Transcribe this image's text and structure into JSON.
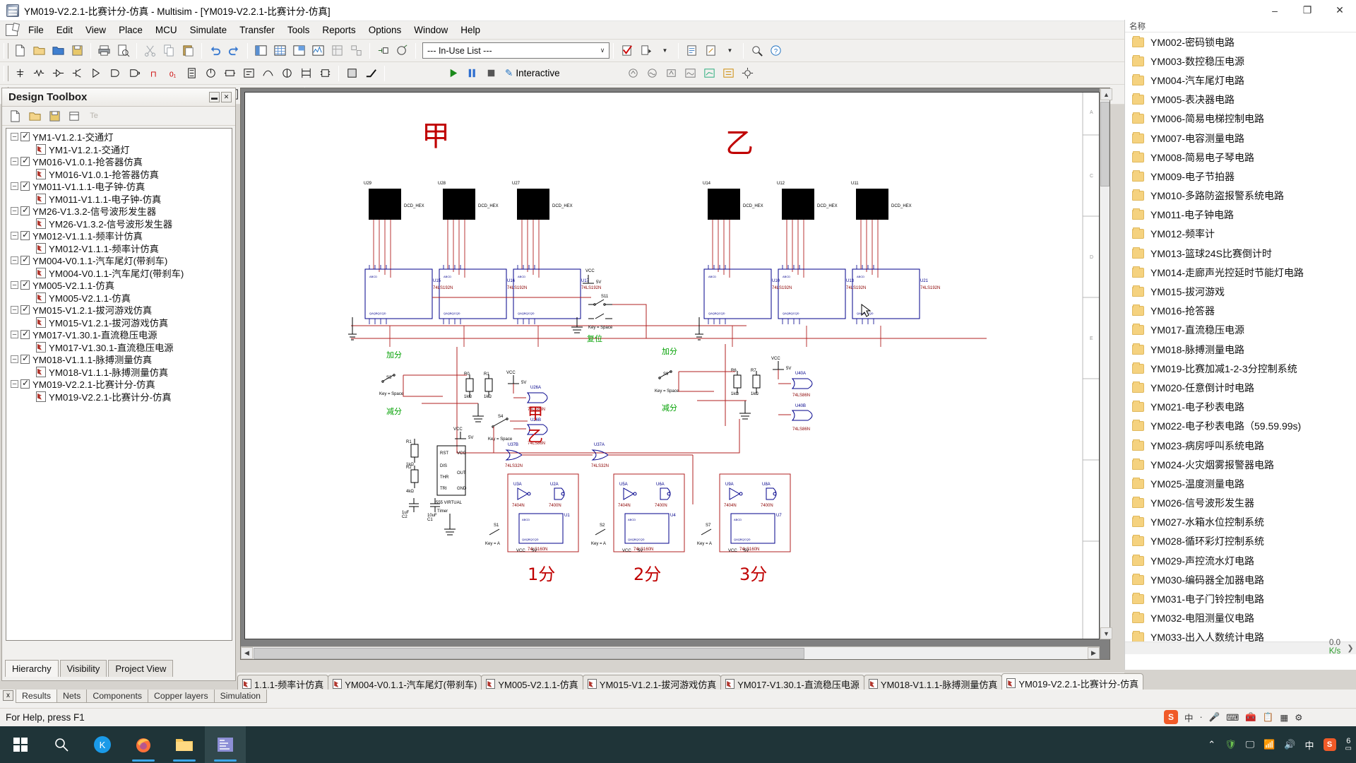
{
  "window": {
    "title": "YM019-V2.2.1-比赛计分-仿真 - Multisim - [YM019-V2.2.1-比赛计分-仿真]",
    "minimize": "–",
    "maximize": "❐",
    "close": "✕"
  },
  "menu": [
    "File",
    "Edit",
    "View",
    "Place",
    "MCU",
    "Simulate",
    "Transfer",
    "Tools",
    "Reports",
    "Options",
    "Window",
    "Help"
  ],
  "toolbar": {
    "in_use_list": "--- In-Use List ---",
    "interactive_label": "Interactive",
    "run_tooltip": "Run",
    "pause_tooltip": "Pause",
    "stop_tooltip": "Stop"
  },
  "design_toolbox": {
    "title": "Design Toolbox",
    "collapse": "▬",
    "close": "✕",
    "tools": [
      "new-sheet-icon",
      "open-icon",
      "save-icon",
      "rename-icon",
      "Te"
    ],
    "tree": [
      {
        "level": 0,
        "label": "YM1-V1.2.1-交通灯",
        "kind": "project"
      },
      {
        "level": 1,
        "label": "YM1-V1.2.1-交通灯",
        "kind": "file"
      },
      {
        "level": 0,
        "label": "YM016-V1.0.1-抢答器仿真",
        "kind": "project"
      },
      {
        "level": 1,
        "label": "YM016-V1.0.1-抢答器仿真",
        "kind": "file"
      },
      {
        "level": 0,
        "label": "YM011-V1.1.1-电子钟-仿真",
        "kind": "project"
      },
      {
        "level": 1,
        "label": "YM011-V1.1.1-电子钟-仿真",
        "kind": "file"
      },
      {
        "level": 0,
        "label": "YM26-V1.3.2-信号波形发生器",
        "kind": "project"
      },
      {
        "level": 1,
        "label": "YM26-V1.3.2-信号波形发生器",
        "kind": "file"
      },
      {
        "level": 0,
        "label": "YM012-V1.1.1-频率计仿真",
        "kind": "project"
      },
      {
        "level": 1,
        "label": "YM012-V1.1.1-频率计仿真",
        "kind": "file"
      },
      {
        "level": 0,
        "label": "YM004-V0.1.1-汽车尾灯(带刹车)",
        "kind": "project"
      },
      {
        "level": 1,
        "label": "YM004-V0.1.1-汽车尾灯(带刹车)",
        "kind": "file"
      },
      {
        "level": 0,
        "label": "YM005-V2.1.1-仿真",
        "kind": "project"
      },
      {
        "level": 1,
        "label": "YM005-V2.1.1-仿真",
        "kind": "file"
      },
      {
        "level": 0,
        "label": "YM015-V1.2.1-拔河游戏仿真",
        "kind": "project"
      },
      {
        "level": 1,
        "label": "YM015-V1.2.1-拔河游戏仿真",
        "kind": "file"
      },
      {
        "level": 0,
        "label": "YM017-V1.30.1-直流稳压电源",
        "kind": "project"
      },
      {
        "level": 1,
        "label": "YM017-V1.30.1-直流稳压电源",
        "kind": "file"
      },
      {
        "level": 0,
        "label": "YM018-V1.1.1-脉搏测量仿真",
        "kind": "project"
      },
      {
        "level": 1,
        "label": "YM018-V1.1.1-脉搏测量仿真",
        "kind": "file"
      },
      {
        "level": 0,
        "label": "YM019-V2.2.1-比赛计分-仿真",
        "kind": "project"
      },
      {
        "level": 1,
        "label": "YM019-V2.2.1-比赛计分-仿真",
        "kind": "file"
      }
    ],
    "panel_tabs": [
      {
        "label": "Hierarchy",
        "active": true
      },
      {
        "label": "Visibility",
        "active": false
      },
      {
        "label": "Project View",
        "active": false
      }
    ]
  },
  "explorer": {
    "header": "名称",
    "items": [
      "YM002-密码锁电路",
      "YM003-数控稳压电源",
      "YM004-汽车尾灯电路",
      "YM005-表决器电路",
      "YM006-简易电梯控制电路",
      "YM007-电容测量电路",
      "YM008-简易电子琴电路",
      "YM009-电子节拍器",
      "YM010-多路防盗报警系统电路",
      "YM011-电子钟电路",
      "YM012-频率计",
      "YM013-篮球24S比赛倒计时",
      "YM014-走廊声光控延时节能灯电路",
      "YM015-拔河游戏",
      "YM016-抢答器",
      "YM017-直流稳压电源",
      "YM018-脉搏测量电路",
      "YM019-比赛加减1-2-3分控制系统",
      "YM020-任意倒计时电路",
      "YM021-电子秒表电路",
      "YM022-电子秒表电路（59.59.99s)",
      "YM023-病房呼叫系统电路",
      "YM024-火灾烟雾报警器电路",
      "YM025-温度测量电路",
      "YM026-信号波形发生器",
      "YM027-水箱水位控制系统",
      "YM028-循环彩灯控制系统",
      "YM029-声控流水灯电路",
      "YM030-编码器全加器电路",
      "YM031-电子门铃控制电路",
      "YM032-电阻测量仪电路",
      "YM033-出入人数统计电路"
    ],
    "scroll_right": "❯",
    "net_speed": "0.0",
    "net_unit": "K/s"
  },
  "doc_tabs": [
    {
      "label": "1.1.1-频率计仿真",
      "active": false
    },
    {
      "label": "YM004-V0.1.1-汽车尾灯(带刹车)",
      "active": false
    },
    {
      "label": "YM005-V2.1.1-仿真",
      "active": false
    },
    {
      "label": "YM015-V1.2.1-拔河游戏仿真",
      "active": false
    },
    {
      "label": "YM017-V1.30.1-直流稳压电源",
      "active": false
    },
    {
      "label": "YM018-V1.1.1-脉搏测量仿真",
      "active": false
    },
    {
      "label": "YM019-V2.2.1-比赛计分-仿真",
      "active": true
    }
  ],
  "tab_nav": [
    "◀",
    "▶",
    "❐"
  ],
  "spreadsheet_tabs": [
    {
      "label": "Results",
      "active": true
    },
    {
      "label": "Nets",
      "active": false
    },
    {
      "label": "Components",
      "active": false
    },
    {
      "label": "Copper layers",
      "active": false
    },
    {
      "label": "Simulation",
      "active": false
    }
  ],
  "status_bar": {
    "text": "For Help, press F1"
  },
  "ime": {
    "brand": "S",
    "mode": "中",
    "dot": "·",
    "icons": [
      "mic-icon",
      "keyboard-icon",
      "toolbox-icon",
      "clipboard-icon",
      "grid-icon",
      "settings-icon"
    ]
  },
  "taskbar": {
    "items": [
      "start-icon",
      "search-icon",
      "kugou-icon",
      "firefox-icon",
      "explorer-icon",
      "multisim-icon"
    ],
    "tray": [
      "chevron-up-icon",
      "shield-icon",
      "network-icon",
      "volume-icon"
    ],
    "ime_label": "中",
    "sogou_label": "S",
    "notification_count": "6"
  },
  "schematic": {
    "labels": {
      "team_left": "甲",
      "team_right": "乙",
      "team_left_low": "甲",
      "team_right_low": "乙",
      "reset": "复位",
      "add_left": "加分",
      "sub_left": "减分",
      "add_right": "加分",
      "sub_right": "减分",
      "score1": "1分",
      "score2": "2分",
      "score3": "3分"
    },
    "displays": [
      {
        "ref": "U29",
        "type": "DCD_HEX"
      },
      {
        "ref": "U28",
        "type": "DCD_HEX"
      },
      {
        "ref": "U27",
        "type": "DCD_HEX"
      },
      {
        "ref": "U14",
        "type": "DCD_HEX"
      },
      {
        "ref": "U12",
        "type": "DCD_HEX"
      },
      {
        "ref": "U11",
        "type": "DCD_HEX"
      }
    ],
    "counters": [
      {
        "ref": "U15",
        "part": "74LS192N"
      },
      {
        "ref": "U16",
        "part": "74LS192N"
      },
      {
        "ref": "U17",
        "part": "74LS192N"
      },
      {
        "ref": "U10",
        "part": "74LS192N"
      },
      {
        "ref": "U13",
        "part": "74LS192N"
      },
      {
        "ref": "U21",
        "part": "74LS192N"
      }
    ],
    "gates": [
      {
        "ref": "U26A",
        "part": "74LS86N"
      },
      {
        "ref": "U26B",
        "part": "74LS86N"
      },
      {
        "ref": "U40A",
        "part": "74LS86N"
      },
      {
        "ref": "U40B",
        "part": "74LS86N"
      },
      {
        "ref": "U37B",
        "part": "74LS32N"
      },
      {
        "ref": "U37A",
        "part": "74LS32N"
      }
    ],
    "switches": [
      {
        "ref": "S11",
        "key": "Key = Space"
      },
      {
        "ref": "S3",
        "key": "Key = Space"
      },
      {
        "ref": "S9",
        "key": "Key = Space"
      },
      {
        "ref": "S4",
        "key": "Key = Space"
      },
      {
        "ref": "S1",
        "key": "Key = A"
      },
      {
        "ref": "S2",
        "key": "Key = A"
      },
      {
        "ref": "S7",
        "key": "Key = A"
      }
    ],
    "power": {
      "net": "VCC",
      "value": "5V"
    },
    "resistors": [
      {
        "ref": "R0",
        "value": "1kΩ"
      },
      {
        "ref": "R1",
        "value": "1kΩ"
      },
      {
        "ref": "R6",
        "value": "1kΩ"
      },
      {
        "ref": "R7",
        "value": "1kΩ"
      },
      {
        "ref": "R1b",
        "value": "1kΩ"
      },
      {
        "ref": "R2",
        "value": "4kΩ"
      }
    ],
    "timer": {
      "ref": "U5",
      "part": "555",
      "sub": "VIRTUAL",
      "name": "Timer"
    },
    "caps": [
      {
        "ref": "C2",
        "value": "1uF"
      },
      {
        "ref": "C1",
        "value": "10uF"
      }
    ],
    "decoders": [
      {
        "ref": "U3A",
        "part": "7404N"
      },
      {
        "ref": "U1",
        "part": "74LS160N"
      },
      {
        "ref": "U5A",
        "part": "7404N"
      },
      {
        "ref": "U4",
        "part": "74LS160N"
      },
      {
        "ref": "U9A",
        "part": "7404N"
      },
      {
        "ref": "U7",
        "part": "74LS160N"
      },
      {
        "ref": "U2A",
        "part": "7400N"
      },
      {
        "ref": "U6A",
        "part": "7400N"
      },
      {
        "ref": "U8A",
        "part": "7400N"
      }
    ],
    "ruler_marks": [
      "A",
      "C",
      "D",
      "E"
    ]
  }
}
